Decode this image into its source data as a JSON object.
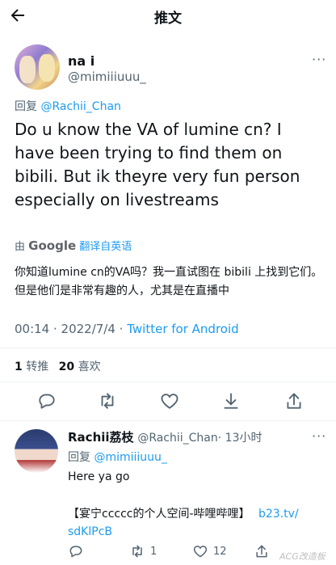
{
  "header": {
    "title": "推文"
  },
  "tweet": {
    "author_name": "na i",
    "author_handle": "@mimiiiuuu_",
    "reply_prefix": "回复",
    "reply_to": "@Rachii_Chan",
    "text": "Do u know the VA of lumine cn? I have been trying to find them on bibili. But ik theyre very fun person especially on livestreams",
    "translate_by": "由",
    "google": "Google",
    "translate_label": "翻译自英语",
    "translation": "你知道lumine cn的VA吗？我一直试图在 bibili 上找到它们。但是他们是非常有趣的人，尤其是在直播中",
    "meta_time": "00:14 · 2022/7/4 · ",
    "meta_source": "Twitter for Android",
    "retweets_count": "1",
    "retweets_label": "转推",
    "likes_count": "20",
    "likes_label": "喜欢"
  },
  "reply": {
    "author_name": "Rachii荔枝",
    "author_handle": "@Rachii_Chan",
    "time": "· 13小时",
    "reply_prefix": "回复",
    "reply_to": "@mimiiiuuu_",
    "text1": "Here ya go",
    "text2": "【宴宁ccccc的个人空间-哔哩哔哩】",
    "link1": "b23.tv/",
    "link2": "sdKlPcB",
    "retweet_count": "1",
    "like_count": "12"
  },
  "watermark": "ACG改造板"
}
